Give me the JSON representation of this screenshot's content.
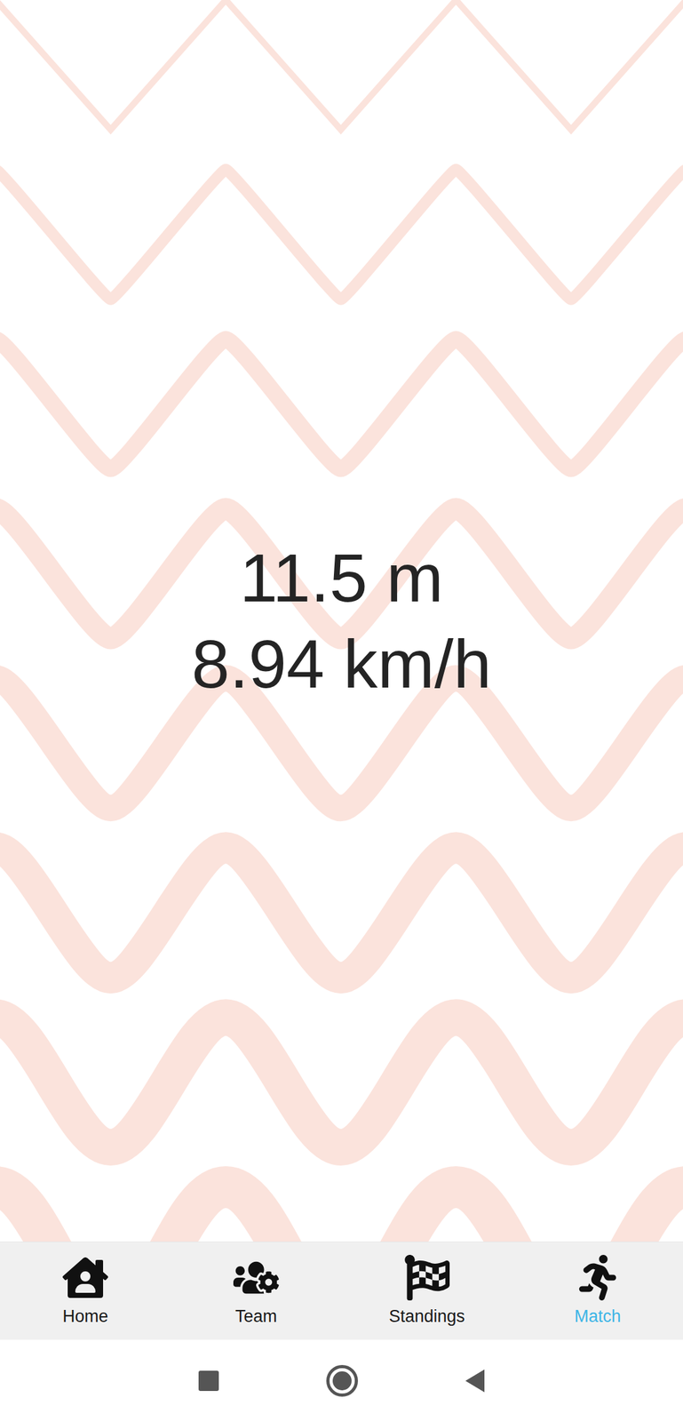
{
  "screen": {
    "distance": "11.5 m",
    "speed": "8.94 km/h"
  },
  "nav": [
    {
      "label": "Home",
      "selected": false
    },
    {
      "label": "Team",
      "selected": false
    },
    {
      "label": "Standings",
      "selected": false
    },
    {
      "label": "Match",
      "selected": true
    }
  ]
}
